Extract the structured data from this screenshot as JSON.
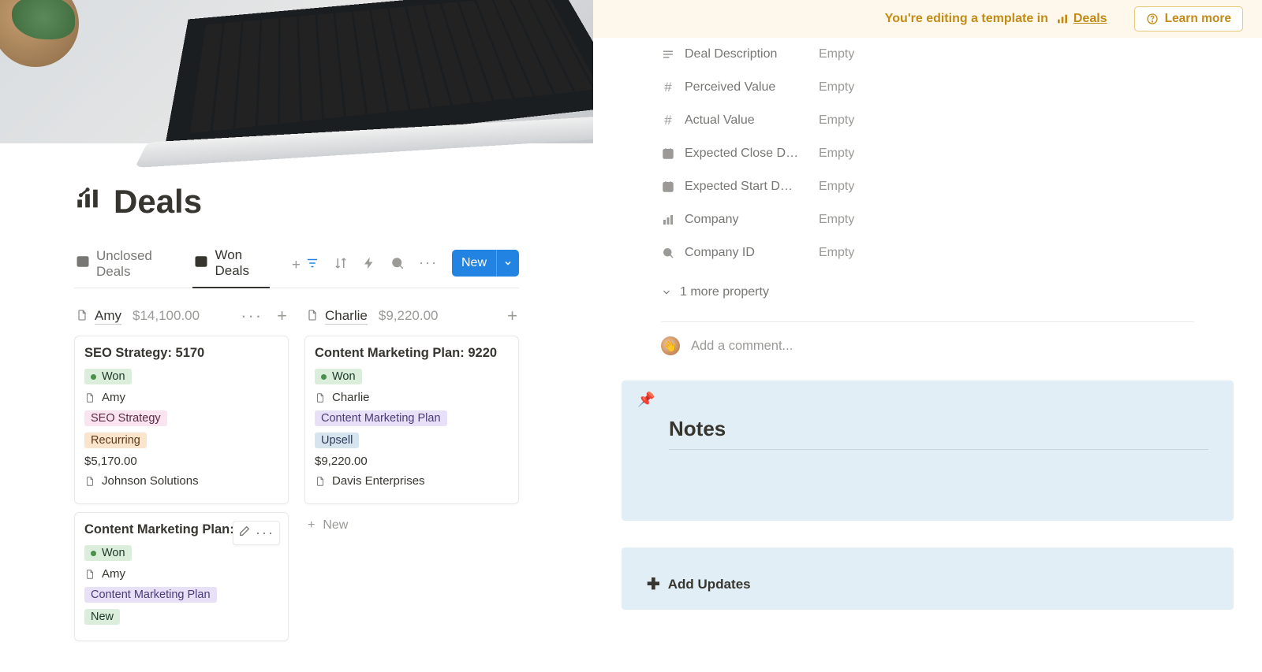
{
  "page": {
    "title": "Deals"
  },
  "tabs": {
    "items": [
      {
        "label": "Unclosed Deals"
      },
      {
        "label": "Won Deals"
      }
    ],
    "newButton": "New"
  },
  "board": {
    "columns": [
      {
        "name": "Amy",
        "total": "$14,100.00",
        "cards": [
          {
            "title": "SEO Strategy: 5170",
            "status": "Won",
            "person": "Amy",
            "tags": [
              {
                "text": "SEO Strategy",
                "cls": "seo"
              },
              {
                "text": "Recurring",
                "cls": "recur"
              }
            ],
            "amount": "$5,170.00",
            "company": "Johnson Solutions"
          },
          {
            "title": "Content Marketing Plan: 893",
            "status": "Won",
            "person": "Amy",
            "tags": [
              {
                "text": "Content Marketing Plan",
                "cls": "cmp"
              },
              {
                "text": "New",
                "cls": "newtag"
              }
            ],
            "showEdit": true
          }
        ]
      },
      {
        "name": "Charlie",
        "total": "$9,220.00",
        "cards": [
          {
            "title": "Content Marketing Plan: 9220",
            "status": "Won",
            "person": "Charlie",
            "tags": [
              {
                "text": "Content Marketing Plan",
                "cls": "cmp"
              },
              {
                "text": "Upsell",
                "cls": "upsell"
              }
            ],
            "amount": "$9,220.00",
            "company": "Davis Enterprises"
          }
        ],
        "newLabel": "New"
      }
    ]
  },
  "banner": {
    "text": "You're editing a template in",
    "linkText": "Deals",
    "learnMore": "Learn more"
  },
  "properties": [
    {
      "icon": "text",
      "label": "Deal Description",
      "value": "Empty"
    },
    {
      "icon": "number",
      "label": "Perceived Value",
      "value": "Empty"
    },
    {
      "icon": "number",
      "label": "Actual Value",
      "value": "Empty"
    },
    {
      "icon": "date",
      "label": "Expected Close D…",
      "value": "Empty"
    },
    {
      "icon": "date",
      "label": "Expected Start D…",
      "value": "Empty"
    },
    {
      "icon": "relation",
      "label": "Company",
      "value": "Empty"
    },
    {
      "icon": "search",
      "label": "Company ID",
      "value": "Empty"
    }
  ],
  "moreProperties": "1 more property",
  "comment": {
    "placeholder": "Add a comment..."
  },
  "notes": {
    "heading": "Notes"
  },
  "updates": {
    "label": "Add Updates"
  }
}
